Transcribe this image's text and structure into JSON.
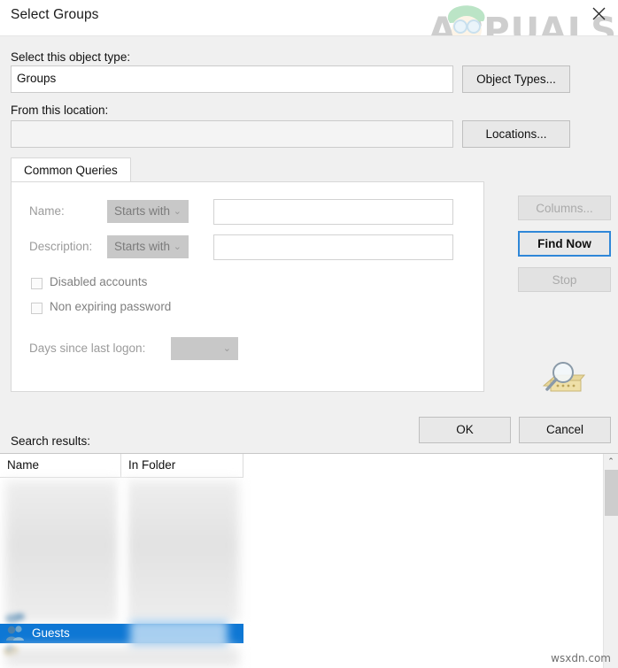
{
  "window": {
    "title": "Select Groups",
    "close_label": "×"
  },
  "watermark": {
    "brand": "APPUALS",
    "site": "wsxdn.com"
  },
  "object_type": {
    "label": "Select this object type:",
    "value": "Groups",
    "button": "Object Types..."
  },
  "location": {
    "label": "From this location:",
    "value": "",
    "button": "Locations..."
  },
  "tabs": [
    {
      "label": "Common Queries",
      "selected": true
    }
  ],
  "query_form": {
    "name": {
      "label": "Name:",
      "operator": "Starts with",
      "value": "",
      "caret": "⌄"
    },
    "description": {
      "label": "Description:",
      "operator": "Starts with",
      "value": "",
      "caret": "⌄"
    },
    "disabled_accounts": {
      "label": "Disabled accounts",
      "checked": false
    },
    "non_expiring_password": {
      "label": "Non expiring password",
      "checked": false
    },
    "days_since_last_logon": {
      "label": "Days since last logon:",
      "value": "",
      "caret": "⌄"
    }
  },
  "side_buttons": {
    "columns": {
      "label": "Columns...",
      "enabled": false
    },
    "find_now": {
      "label": "Find Now",
      "enabled": true,
      "focused": true
    },
    "stop": {
      "label": "Stop",
      "enabled": false
    }
  },
  "dialog_buttons": {
    "ok": "OK",
    "cancel": "Cancel"
  },
  "search_results": {
    "label": "Search results:",
    "columns": [
      "Name",
      "In Folder"
    ],
    "rows": [
      {
        "name": "",
        "in_folder": "",
        "redacted": true,
        "selected": false
      },
      {
        "name": "",
        "in_folder": "",
        "redacted": true,
        "selected": false
      },
      {
        "name": "",
        "in_folder": "",
        "redacted": true,
        "selected": false
      },
      {
        "name": "",
        "in_folder": "",
        "redacted": true,
        "selected": false
      },
      {
        "name": "",
        "in_folder": "",
        "redacted": true,
        "selected": false
      },
      {
        "name": "",
        "in_folder": "",
        "redacted": true,
        "selected": false
      },
      {
        "name": "Guests",
        "in_folder": "",
        "redacted": false,
        "selected": true
      }
    ],
    "selected_row_name": "Guests"
  },
  "scrollbar": {
    "up_arrow": "⌃"
  },
  "colors": {
    "dialog_bg": "#f0f0f0",
    "selection_blue": "#0e77d4",
    "focus_blue": "#2f87d8",
    "disabled_text": "#aaaaaa"
  }
}
